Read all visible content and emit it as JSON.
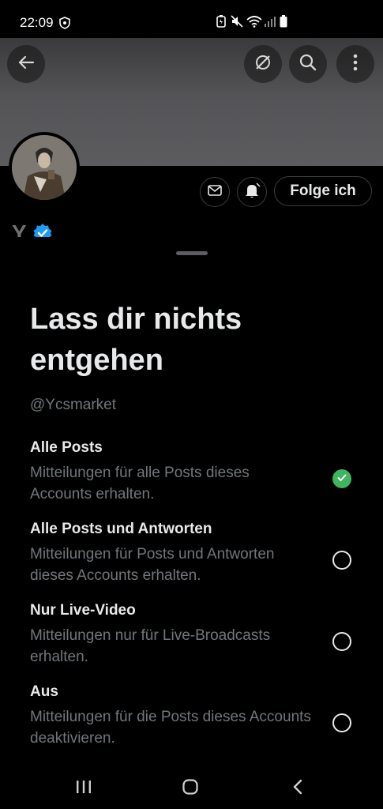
{
  "status_bar": {
    "time": "22:09"
  },
  "profile": {
    "name_initial": "Y",
    "follow_label": "Folge ich"
  },
  "sheet": {
    "title": "Lass dir nichts entgehen",
    "handle": "@Ycsmarket",
    "options": [
      {
        "title": "Alle Posts",
        "description": "Mitteilungen für alle Posts dieses Accounts erhalten.",
        "selected": true
      },
      {
        "title": "Alle Posts und Antworten",
        "description": "Mitteilungen für Posts und Antworten dieses Accounts erhalten.",
        "selected": false
      },
      {
        "title": "Nur Live-Video",
        "description": "Mitteilungen nur für Live-Broadcasts erhalten.",
        "selected": false
      },
      {
        "title": "Aus",
        "description": "Mitteilungen für die Posts dieses Accounts deaktivieren.",
        "selected": false
      }
    ]
  },
  "colors": {
    "accent_green": "#3fb560",
    "verified_blue": "#1d9bf0",
    "text_primary": "#e7e9ea",
    "text_secondary": "#71767b"
  },
  "icons": {
    "back": "arrow-left-icon",
    "grok": "grok-icon",
    "search": "search-icon",
    "more": "more-vertical-icon",
    "message": "envelope-icon",
    "notifications": "bell-icon"
  }
}
